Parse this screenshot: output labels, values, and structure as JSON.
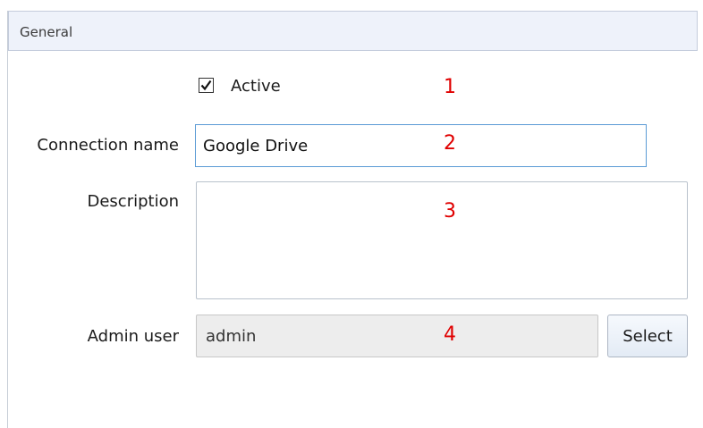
{
  "panel": {
    "header_title": "General"
  },
  "form": {
    "active": {
      "label": "Active",
      "checked": true
    },
    "connection_name": {
      "label": "Connection name",
      "value": "Google Drive"
    },
    "description": {
      "label": "Description",
      "value": ""
    },
    "admin_user": {
      "label": "Admin user",
      "value": "admin",
      "select_label": "Select"
    }
  },
  "annotations": {
    "marker_1": "1",
    "marker_2": "2",
    "marker_3": "3",
    "marker_4": "4",
    "color": "#e00000"
  },
  "colors": {
    "header_bg": "#eef2fa",
    "focus_border": "#5b9bd5",
    "readonly_bg": "#ededed"
  }
}
